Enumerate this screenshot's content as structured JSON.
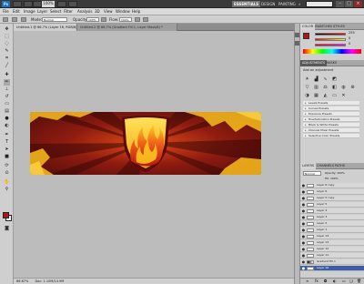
{
  "app": {
    "logo": "Ps"
  },
  "options_bar": {
    "zoom": "100%"
  },
  "workspaces": [
    "ESSENTIALS",
    "DESIGN",
    "PAINTING",
    "»"
  ],
  "menu": [
    "File",
    "Edit",
    "Image",
    "Layer",
    "Select",
    "Filter",
    "Analysis",
    "3D",
    "View",
    "Window",
    "Help"
  ],
  "options": {
    "mode_label": "Mode:",
    "mode_value": "Normal",
    "opacity_label": "Opacity:",
    "opacity_value": "100%",
    "flow_label": "Flow:",
    "flow_value": "100%"
  },
  "tabs": [
    {
      "label": "Untitled-1 @ 66.7% (Layer 16, RGB/8) *"
    },
    {
      "label": "Untitled-2 @ 66.7% (Gradient Fill 1, Layer Mask/8) *"
    }
  ],
  "status": {
    "zoom": "66.67%",
    "doc": "Doc: 1.10M/14.9M"
  },
  "colors": {
    "fg": "#b31217",
    "bg": "#ffffff",
    "accent": "#3d5da7"
  },
  "panels": {
    "color_tabs": [
      "COLOR",
      "SWATCHES",
      "STYLES"
    ],
    "color_values": {
      "r": "255",
      "g": "0",
      "b": "0"
    },
    "adjust_tabs": [
      "ADJUSTMENTS",
      "MASKS"
    ],
    "adjust_title": "Add an adjustment",
    "presets": [
      "Levels Presets",
      "Curves Presets",
      "Exposure Presets",
      "Hue/Saturation Presets",
      "Black & White Presets",
      "Channel Mixer Presets",
      "Selective Color Presets"
    ],
    "layer_tabs": [
      "LAYERS",
      "CHANNELS",
      "PATHS"
    ],
    "layer_mode": "Normal",
    "layer_opacity": "Opacity: 100%",
    "layer_fill": "Fill: 100%",
    "layers": [
      "Layer 6 copy",
      "Layer 6",
      "Layer 5 copy",
      "Layer 5",
      "Layer 4",
      "Layer 3",
      "Layer 2",
      "Layer 1",
      "Layer 14",
      "Layer 13",
      "Layer 12",
      "Layer 11",
      "Gradient Fill 1",
      "Layer 16"
    ],
    "selected_layer": "Layer 16"
  },
  "icons": {
    "tools": [
      "move-tool-icon",
      "marquee-tool-icon",
      "lasso-tool-icon",
      "quick-select-tool-icon",
      "crop-tool-icon",
      "eyedropper-tool-icon",
      "healing-tool-icon",
      "brush-tool-icon",
      "clone-stamp-tool-icon",
      "history-brush-tool-icon",
      "eraser-tool-icon",
      "gradient-tool-icon",
      "blur-tool-icon",
      "dodge-tool-icon",
      "pen-tool-icon",
      "type-tool-icon",
      "path-select-tool-icon",
      "shape-tool-icon",
      "3d-rotate-tool-icon",
      "3d-orbit-tool-icon",
      "hand-tool-icon",
      "zoom-tool-icon"
    ]
  }
}
